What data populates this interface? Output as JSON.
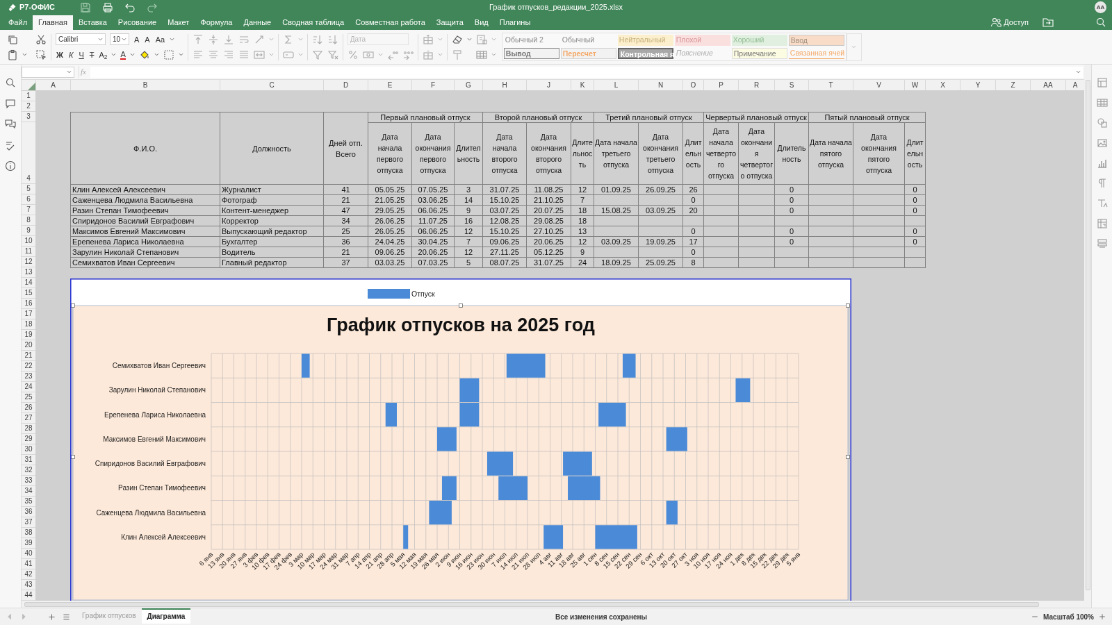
{
  "app": {
    "logo": "Р7-ОФИС",
    "title": "График отпусков_редакции_2025.xlsx",
    "avatar": "AA"
  },
  "menu": [
    {
      "label": "Файл",
      "selected": false
    },
    {
      "label": "Главная",
      "selected": true
    },
    {
      "label": "Вставка",
      "selected": false
    },
    {
      "label": "Рисование",
      "selected": false
    },
    {
      "label": "Макет",
      "selected": false
    },
    {
      "label": "Формула",
      "selected": false
    },
    {
      "label": "Данные",
      "selected": false
    },
    {
      "label": "Сводная таблица",
      "selected": false
    },
    {
      "label": "Совместная работа",
      "selected": false
    },
    {
      "label": "Защита",
      "selected": false
    },
    {
      "label": "Вид",
      "selected": false
    },
    {
      "label": "Плагины",
      "selected": false
    }
  ],
  "share": "Доступ",
  "toolbar": {
    "font": "Calibri",
    "size": "10",
    "grow": "A",
    "shrink": "A",
    "case": "Aa",
    "bold": "Ж",
    "italic": "К",
    "underline": "Ч",
    "strike": "Т",
    "subscript": "A$_{2}$",
    "font_color": "A",
    "number_format": {
      "placeholder": "Дата",
      "disabled": true
    },
    "styles": [
      {
        "label": "Обычный 2",
        "kind": "plain"
      },
      {
        "label": "Обычный",
        "kind": "plain"
      },
      {
        "label": "Нейтральный",
        "kind": "neutral"
      },
      {
        "label": "Плохой",
        "kind": "bad"
      },
      {
        "label": "Хороший",
        "kind": "good"
      },
      {
        "label": "Ввод",
        "kind": "input"
      },
      {
        "label": "Вывод",
        "kind": "output"
      },
      {
        "label": "Пересчет",
        "kind": "calc"
      },
      {
        "label": "Контрольная я",
        "kind": "check"
      },
      {
        "label": "Пояснение",
        "kind": "explain"
      },
      {
        "label": "Примечание",
        "kind": "note"
      },
      {
        "label": "Связанная ячей",
        "kind": "linked"
      }
    ]
  },
  "formula_bar": {
    "function_label": "fx"
  },
  "sheet": {
    "columns": [
      "A",
      "B",
      "C",
      "D",
      "E",
      "F",
      "G",
      "H",
      "J",
      "K",
      "L",
      "N",
      "O",
      "P",
      "R",
      "S",
      "T",
      "V",
      "W",
      "X",
      "Y",
      "Z",
      "AA",
      "A"
    ],
    "rows": [
      "1",
      "2",
      "3",
      "4",
      "5",
      "6",
      "7",
      "8",
      "9",
      "10",
      "11",
      "12",
      "13",
      "14",
      "15",
      "16",
      "17",
      "18",
      "19",
      "20",
      "21",
      "22",
      "23",
      "24",
      "25",
      "26",
      "27",
      "28",
      "29",
      "30",
      "31",
      "32",
      "33",
      "34",
      "35",
      "36",
      "37",
      "38",
      "39",
      "40",
      "41",
      "42",
      "43",
      "44"
    ]
  },
  "table": {
    "headers": [
      "Ф.И.О.",
      "Должность",
      "Дней отп. Всего"
    ],
    "groups": [
      {
        "title": "Первый плановый отпуск",
        "columns": [
          "Дата начала первого отпуска",
          "Дата окончания первого отпуска",
          "Длительность"
        ]
      },
      {
        "title": "Второй плановый отпуск",
        "columns": [
          "Дата начала второго отпуска",
          "Дата окончания второго отпуска",
          "Длительность"
        ]
      },
      {
        "title": "Третий плановый отпуск",
        "columns": [
          "Дата начала третьего отпуска",
          "Дата окончания третьего отпуска",
          "Длительность"
        ]
      },
      {
        "title": "Червертый плановый отпуск",
        "columns": [
          "Дата начала четвертого отпуска",
          "Дата окончания четвертого отпуска",
          "Длительность"
        ]
      },
      {
        "title": "Пятый плановый отпуск",
        "columns": [
          "Дата начала пятого отпуска",
          "Дата окончания пятого отпуска",
          "Длительность"
        ]
      }
    ],
    "rows": [
      {
        "name": "Клин Алексей Алексеевич",
        "position": "Журналист",
        "days": "41",
        "vacations": [
          {
            "start": "05.05.25",
            "end": "07.05.25",
            "duration": "3"
          },
          {
            "start": "31.07.25",
            "end": "11.08.25",
            "duration": "12"
          },
          {
            "start": "01.09.25",
            "end": "26.09.25",
            "duration": "26"
          },
          {
            "duration": "0"
          },
          {
            "duration": "0"
          }
        ]
      },
      {
        "name": "Саженцева Людмила Васильевна",
        "position": "Фотограф",
        "days": "21",
        "vacations": [
          {
            "start": "21.05.25",
            "end": "03.06.25",
            "duration": "14"
          },
          {
            "start": "15.10.25",
            "end": "21.10.25",
            "duration": "7"
          },
          {
            "duration": "0"
          },
          {
            "duration": "0"
          },
          {
            "duration": "0"
          }
        ]
      },
      {
        "name": "Разин Степан Тимофеевич",
        "position": "Контент-менеджер",
        "days": "47",
        "vacations": [
          {
            "start": "29.05.25",
            "end": "06.06.25",
            "duration": "9"
          },
          {
            "start": "03.07.25",
            "end": "20.07.25",
            "duration": "18"
          },
          {
            "start": "15.08.25",
            "end": "03.09.25",
            "duration": "20"
          },
          {
            "duration": "0"
          },
          {
            "duration": "0"
          }
        ]
      },
      {
        "name": "Спиридонов Василий Евграфович",
        "position": "Корректор",
        "days": "34",
        "vacations": [
          {
            "start": "26.06.25",
            "end": "11.07.25",
            "duration": "16"
          },
          {
            "start": "12.08.25",
            "end": "29.08.25",
            "duration": "18"
          }
        ]
      },
      {
        "name": "Максимов Евгений Максимович",
        "position": "Выпускающий редактор",
        "days": "25",
        "vacations": [
          {
            "start": "26.05.25",
            "end": "06.06.25",
            "duration": "12"
          },
          {
            "start": "15.10.25",
            "end": "27.10.25",
            "duration": "13"
          },
          {
            "duration": "0"
          },
          {
            "duration": "0"
          },
          {
            "duration": "0"
          }
        ]
      },
      {
        "name": "Ерепенева Лариса Николаевна",
        "position": "Бухгалтер",
        "days": "36",
        "vacations": [
          {
            "start": "24.04.25",
            "end": "30.04.25",
            "duration": "7"
          },
          {
            "start": "09.06.25",
            "end": "20.06.25",
            "duration": "12"
          },
          {
            "start": "03.09.25",
            "end": "19.09.25",
            "duration": "17"
          },
          {
            "duration": "0"
          },
          {
            "duration": "0"
          }
        ]
      },
      {
        "name": "Зарулин Николай Степанович",
        "position": "Водитель",
        "days": "21",
        "vacations": [
          {
            "start": "09.06.25",
            "end": "20.06.25",
            "duration": "12"
          },
          {
            "start": "27.11.25",
            "end": "05.12.25",
            "duration": "9"
          },
          {
            "duration": "0"
          }
        ]
      },
      {
        "name": "Семихватов Иван Сергеевич",
        "position": "Главный редактор",
        "days": "37",
        "vacations": [
          {
            "start": "03.03.25",
            "end": "07.03.25",
            "duration": "5"
          },
          {
            "start": "08.07.25",
            "end": "31.07.25",
            "duration": "24"
          },
          {
            "start": "18.09.25",
            "end": "25.09.25",
            "duration": "8"
          }
        ]
      }
    ]
  },
  "chart": {
    "title": "График отпусков на 2025 год",
    "legend": {
      "label": "Отпуск",
      "color": "#4a8ad7"
    },
    "row_labels": [
      "Семихватов Иван Сергеевич",
      "Зарулин Николай Степанович",
      "Ерепенева Лариса Николаевна",
      "Максимов Евгений Максимович",
      "Спиридонов Василий Евграфович",
      "Разин Степан Тимофеевич",
      "Саженцева Людмила Васильевна",
      "Клин Алексей Алексеевич"
    ],
    "date_labels": [
      "6 янв",
      "13 янв",
      "20 янв",
      "27 янв",
      "3 фев",
      "10 фев",
      "17 фев",
      "24 фев",
      "3 мар",
      "10 мар",
      "17 мар",
      "24 мар",
      "31 мар",
      "7 апр",
      "14 апр",
      "21 апр",
      "28 апр",
      "5 мая",
      "12 мая",
      "19 мая",
      "26 мая",
      "2 июн",
      "9 июн",
      "16 июн",
      "23 июн",
      "30 июн",
      "7 июл",
      "14 июл",
      "21 июл",
      "28 июл",
      "4 авг",
      "11 авг",
      "18 авг",
      "25 авг",
      "1 сен",
      "8 сен",
      "15 сен",
      "22 сен",
      "29 сен",
      "6 окт",
      "13 окт",
      "20 окт",
      "27 окт",
      "3 ноя",
      "10 ноя",
      "17 ноя",
      "24 ноя",
      "1 дек",
      "8 дек",
      "15 дек",
      "22 дек",
      "29 дек",
      "5 янв"
    ]
  },
  "sheet_tabs": [
    {
      "label": "График отпусков",
      "selected": false
    },
    {
      "label": "Диаграмма",
      "selected": true
    }
  ],
  "status": "Все изменения сохранены",
  "zoom": "Масштаб 100%"
}
